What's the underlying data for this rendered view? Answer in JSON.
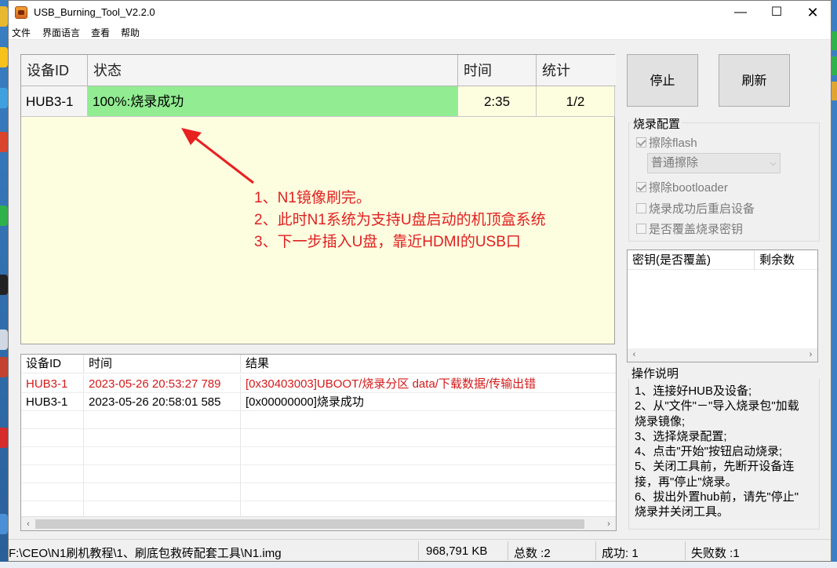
{
  "window": {
    "title": "USB_Burning_Tool_V2.2.0",
    "min": "—",
    "max": "☐",
    "close": "✕"
  },
  "menu": [
    "文件",
    "界面语言",
    "查看",
    "帮助"
  ],
  "grid": {
    "headers": [
      "设备ID",
      "状态",
      "时间",
      "统计"
    ],
    "row": {
      "device": "HUB3-1",
      "status": "100%:烧录成功",
      "time": "2:35",
      "count": "1/2"
    }
  },
  "annotation": [
    "1、N1镜像刷完。",
    "2、此时N1系统为支持U盘启动的机顶盒系统",
    "3、下一步插入U盘，靠近HDMI的USB口"
  ],
  "log": {
    "headers": [
      "设备ID",
      "时间",
      "结果"
    ],
    "rows": [
      {
        "device": "HUB3-1",
        "time": "2023-05-26 20:53:27 789",
        "result": "[0x30403003]UBOOT/烧录分区 data/下载数据/传输出错",
        "error": true
      },
      {
        "device": "HUB3-1",
        "time": "2023-05-26 20:58:01 585",
        "result": "[0x00000000]烧录成功",
        "error": false
      }
    ]
  },
  "buttons": {
    "stop": "停止",
    "refresh": "刷新"
  },
  "config": {
    "label": "烧录配置",
    "erase_flash": "擦除flash",
    "erase_mode": "普通擦除",
    "erase_bootloader": "擦除bootloader",
    "reboot_after": "烧录成功后重启设备",
    "overwrite_key": "是否覆盖烧录密钥"
  },
  "keys": {
    "headers": [
      "密钥(是否覆盖)",
      "剩余数"
    ]
  },
  "instructions": {
    "title": "操作说明",
    "lines": [
      "1、连接好HUB及设备;",
      "2、从\"文件\"－\"导入烧录包\"加载",
      "烧录镜像;",
      "3、选择烧录配置;",
      "4、点击\"开始\"按钮启动烧录;",
      "5、关闭工具前，先断开设备连",
      "接，再\"停止\"烧录。",
      "6、拔出外置hub前，请先\"停止\"",
      "烧录并关闭工具。"
    ]
  },
  "status": {
    "path": "F:\\CEO\\N1刷机教程\\1、刷底包救砖配套工具\\N1.img",
    "size": "968,791 KB",
    "total": "总数 :2",
    "success": "成功: 1",
    "fail": "失败数 :1"
  }
}
